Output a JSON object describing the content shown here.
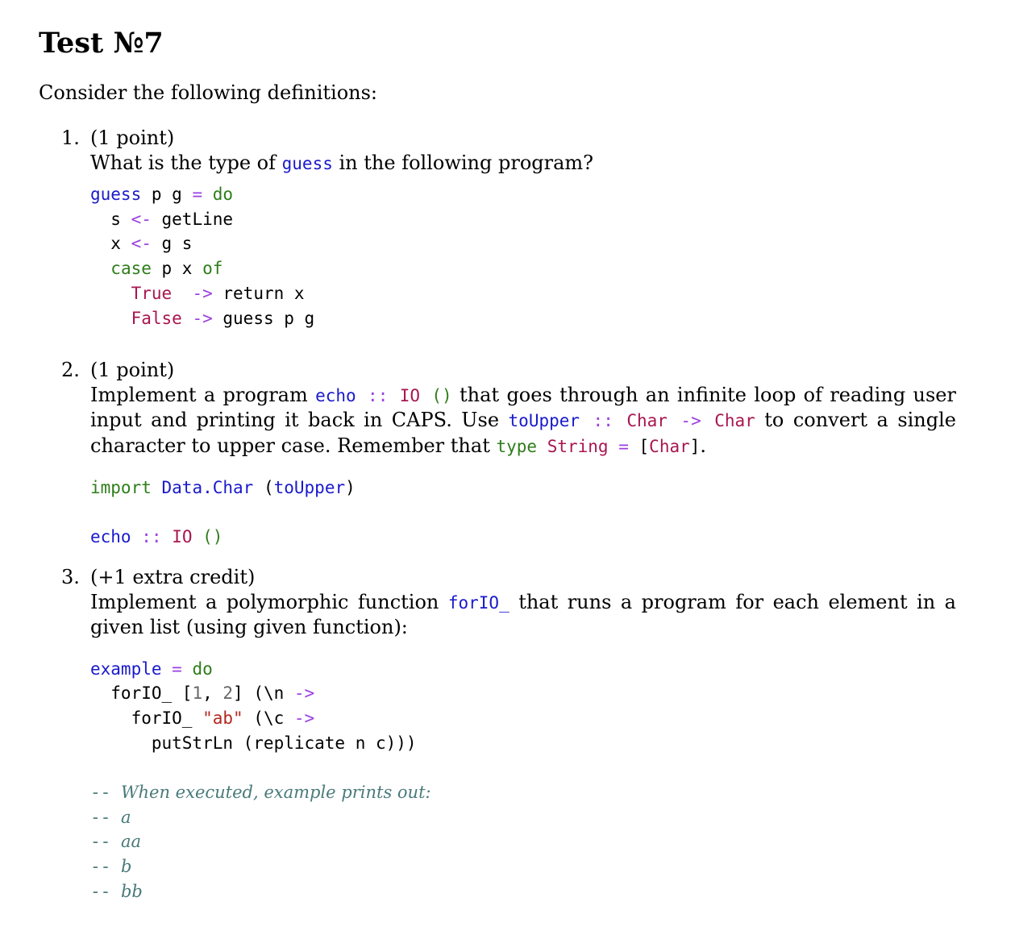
{
  "title": "Test №7",
  "intro": "Consider the following definitions:",
  "questions": [
    {
      "number": "1.",
      "points": "(1 point)",
      "prompt_before": "What is the type of",
      "prompt_code": "guess",
      "prompt_after": "in the following program?",
      "code_lines": [
        "guess p g = do",
        "  s <- getLine",
        "  x <- g s",
        "  case p x of",
        "    True  -> return x",
        "    False -> guess p g"
      ]
    },
    {
      "number": "2.",
      "points": "(1 point)",
      "text": "Implement a program echo :: IO () that goes through an infinite loop of reading user input and printing it back in CAPS. Use toUpper :: Char -> Char to convert a single character to upper case. Remember that type String = [Char].",
      "code_lines": [
        "import Data.Char (toUpper)",
        "",
        "echo :: IO ()"
      ]
    },
    {
      "number": "3.",
      "points": "(+1 extra credit)",
      "text": "Implement a polymorphic function forIO_ that runs a program for each element in a given list (using given function):",
      "code_lines": [
        "example = do",
        "  forIO_ [1, 2] (\\n ->",
        "    forIO_ \"ab\" (\\c ->",
        "      putStrLn (replicate n c)))",
        "",
        "-- When executed, example prints out:",
        "-- a",
        "-- aa",
        "-- b",
        "-- bb"
      ]
    }
  ],
  "colors": {
    "function": "#1a1acc",
    "keyword": "#2e7d1a",
    "operator": "#9b3fe0",
    "type": "#a8164f",
    "string": "#b3271f",
    "number": "#666666",
    "comment": "#4a7a7a"
  }
}
